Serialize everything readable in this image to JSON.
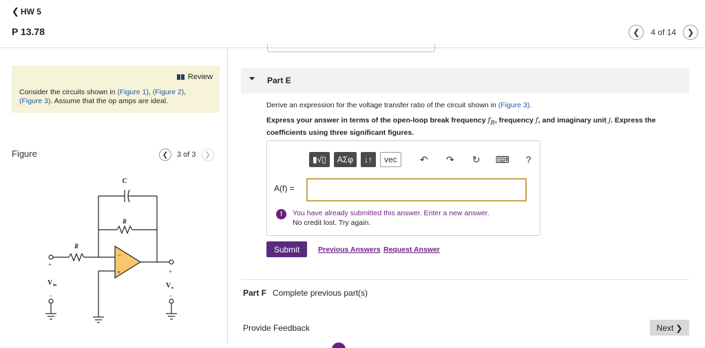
{
  "header": {
    "back_label": "HW 5",
    "problem_title": "P 13.78",
    "pager_count": "4 of 14"
  },
  "context": {
    "review_label": "Review",
    "text_before": "Consider the circuits shown in ",
    "fig1": "(Figure 1)",
    "sep1": ", ",
    "fig2": "(Figure 2)",
    "sep2": ",",
    "fig3": "(Figure 3)",
    "text_after": ". Assume that the op amps are ideal."
  },
  "figure": {
    "label": "Figure",
    "count": "3 of 3",
    "labels": {
      "c": "C",
      "r_feedback": "R",
      "r_input": "R",
      "vin": "V",
      "vin_sub": "in",
      "vo": "V",
      "vo_sub": "o",
      "plus_in": "+",
      "minus_in": "−",
      "plus_out": "+",
      "minus_out": "−",
      "amp_minus": "−",
      "amp_plus": "+"
    }
  },
  "part_e": {
    "label": "Part E",
    "prompt_before": "Derive an expression for the voltage transfer ratio of the circuit shown in ",
    "prompt_fig": "(Figure 3)",
    "prompt_after": ".",
    "instr_1": "Express your answer in terms of the open-loop break frequency ",
    "instr_fb": "f",
    "instr_fb_sub": "B",
    "instr_2": ", frequency ",
    "instr_f": "f",
    "instr_3": ", and imaginary unit ",
    "instr_j": "j",
    "instr_4": ". Express the coefficients using three significant figures.",
    "toolbar": {
      "templates": "▮√▯",
      "greek": "ΑΣφ",
      "arrows": "↓↑",
      "vec": "vec",
      "undo_icon": "↶",
      "redo_icon": "↷",
      "reset_icon": "↻",
      "keyboard_icon": "⌨",
      "help_icon": "?"
    },
    "answer_label": "A(f) =",
    "answer_value": "",
    "warning_line1": "You have already submitted this answer. Enter a new answer.",
    "warning_line2": "No credit lost. Try again.",
    "submit": "Submit",
    "previous_answers": "Previous Answers",
    "request_answer": "Request Answer"
  },
  "part_f": {
    "label": "Part F",
    "description": "Complete previous part(s)"
  },
  "footer": {
    "feedback": "Provide Feedback",
    "next": "Next"
  },
  "colors": {
    "accent_purple": "#5b2a7e",
    "link_blue": "#1b5aa5",
    "context_bg": "#f6f3d9",
    "opamp_fill": "#f7c66d",
    "input_border": "#c9a24a"
  }
}
